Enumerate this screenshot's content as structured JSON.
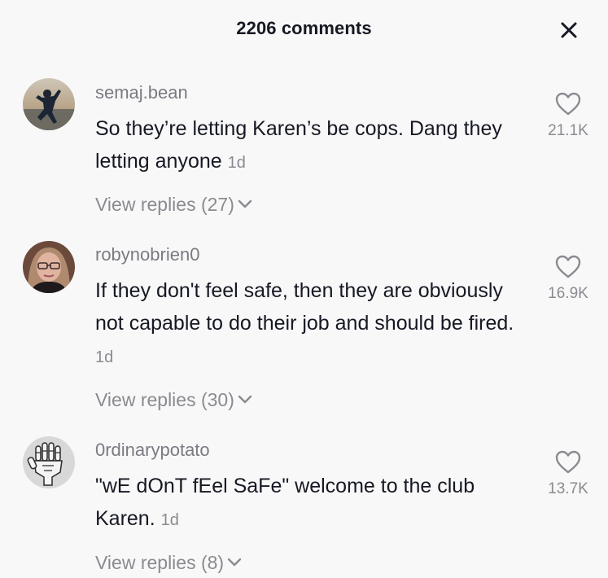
{
  "header": {
    "title": "2206 comments"
  },
  "comments": [
    {
      "username": "semaj.bean",
      "text": "So they’re letting Karen’s be cops. Dang they letting anyone",
      "time": "1d",
      "replies": "View replies (27)",
      "likes": "21.1K",
      "avatar_icon": "person-silhouette-avatar"
    },
    {
      "username": "robynobrien0",
      "text": "If they don't feel safe, then they are obviously not capable to do their job and should be fired.",
      "time": "1d",
      "replies": "View replies (30)",
      "likes": "16.9K",
      "avatar_icon": "woman-glasses-avatar"
    },
    {
      "username": "0rdinarypotato",
      "text": "\"wE dOnT fEel SaFe\" welcome to the club Karen.",
      "time": "1d",
      "replies": "View replies (8)",
      "likes": "13.7K",
      "avatar_icon": "skeleton-hand-avatar"
    }
  ],
  "colors": {
    "background": "#f8f8f8",
    "primary_text": "#161823",
    "secondary_text": "#8a8b91"
  }
}
